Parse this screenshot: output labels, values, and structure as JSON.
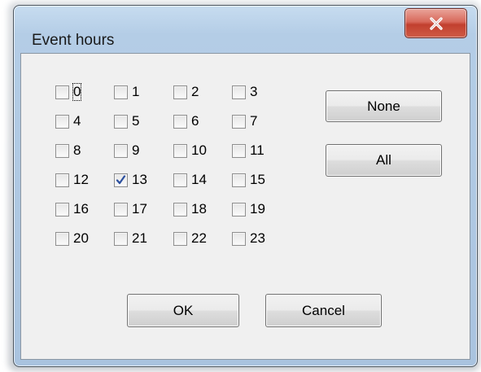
{
  "dialog": {
    "title": "Event hours",
    "close_icon": "close-x-icon"
  },
  "hours": [
    {
      "label": "0",
      "checked": false,
      "focused": true
    },
    {
      "label": "1",
      "checked": false
    },
    {
      "label": "2",
      "checked": false
    },
    {
      "label": "3",
      "checked": false
    },
    {
      "label": "4",
      "checked": false
    },
    {
      "label": "5",
      "checked": false
    },
    {
      "label": "6",
      "checked": false
    },
    {
      "label": "7",
      "checked": false
    },
    {
      "label": "8",
      "checked": false
    },
    {
      "label": "9",
      "checked": false
    },
    {
      "label": "10",
      "checked": false
    },
    {
      "label": "11",
      "checked": false
    },
    {
      "label": "12",
      "checked": false
    },
    {
      "label": "13",
      "checked": true
    },
    {
      "label": "14",
      "checked": false
    },
    {
      "label": "15",
      "checked": false
    },
    {
      "label": "16",
      "checked": false
    },
    {
      "label": "17",
      "checked": false
    },
    {
      "label": "18",
      "checked": false
    },
    {
      "label": "19",
      "checked": false
    },
    {
      "label": "20",
      "checked": false
    },
    {
      "label": "21",
      "checked": false
    },
    {
      "label": "22",
      "checked": false
    },
    {
      "label": "23",
      "checked": false
    }
  ],
  "buttons": {
    "none": "None",
    "all": "All",
    "ok": "OK",
    "cancel": "Cancel"
  },
  "colors": {
    "check_mark": "#2b4f9e"
  }
}
